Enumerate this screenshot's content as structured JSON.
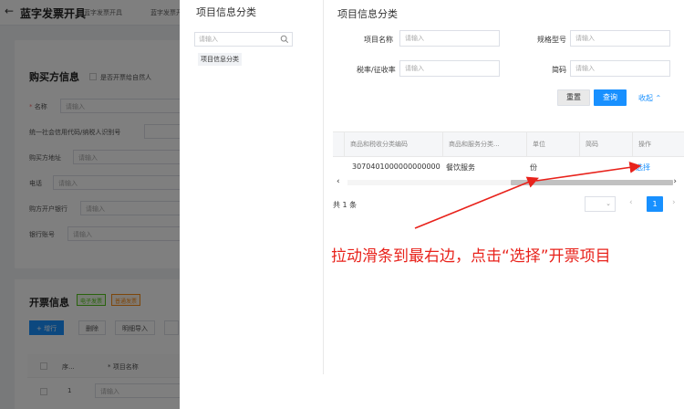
{
  "background": {
    "back_icon": "arrow-left-icon",
    "page_title": "蓝字发票开具",
    "tabs": [
      "蓝字发票开具",
      "蓝字发票开"
    ],
    "buyer_section": {
      "title": "购买方信息",
      "natural_person_label": "是否开票给自然人",
      "fields": [
        {
          "label": "名称",
          "required": true,
          "placeholder": "请输入"
        },
        {
          "label": "统一社会信用代码/纳税人识别号",
          "required": false,
          "placeholder": ""
        },
        {
          "label": "购买方地址",
          "required": false,
          "placeholder": "请输入"
        },
        {
          "label": "电话",
          "required": false,
          "placeholder": "请输入"
        },
        {
          "label": "购方开户银行",
          "required": false,
          "placeholder": "请输入"
        },
        {
          "label": "银行账号",
          "required": false,
          "placeholder": "请输入"
        }
      ]
    },
    "invoice_section": {
      "title": "开票信息",
      "tags": [
        {
          "label": "电子发票",
          "color": "#52c41a"
        },
        {
          "label": "普通发票",
          "color": "#fa8c16"
        }
      ],
      "buttons": [
        "+ 增行",
        "删除",
        "明细导入"
      ],
      "table_headers": [
        "序...",
        "* 项目名称"
      ],
      "table_row": {
        "index": "1",
        "placeholder": "请输入"
      }
    }
  },
  "drawer": {
    "left": {
      "title": "项目信息分类",
      "search_placeholder": "请输入",
      "tree_node": "项目信息分类"
    },
    "right": {
      "title": "项目信息分类",
      "filters": [
        {
          "label": "项目名称",
          "placeholder": "请输入"
        },
        {
          "label": "规格型号",
          "placeholder": "请输入"
        },
        {
          "label": "税率/征收率",
          "placeholder": "请输入"
        },
        {
          "label": "简码",
          "placeholder": "请输入"
        }
      ],
      "reset_label": "重置",
      "query_label": "查询",
      "collapse_label": "收起",
      "table": {
        "headers": [
          "商品和税收分类编码",
          "商品和服务分类...",
          "单位",
          "简码",
          "操作"
        ],
        "rows": [
          {
            "code": "3070401000000000000",
            "category": "餐饮服务",
            "unit": "份",
            "short_code": "",
            "action": "选择"
          }
        ]
      },
      "pagination": {
        "total_text": "共 1 条",
        "current_page": "1",
        "page_size": ""
      }
    }
  },
  "annotation": "拉动滑条到最右边，点击“选择”开票项目",
  "colors": {
    "primary": "#1890ff",
    "annotation_red": "#e8221b"
  }
}
